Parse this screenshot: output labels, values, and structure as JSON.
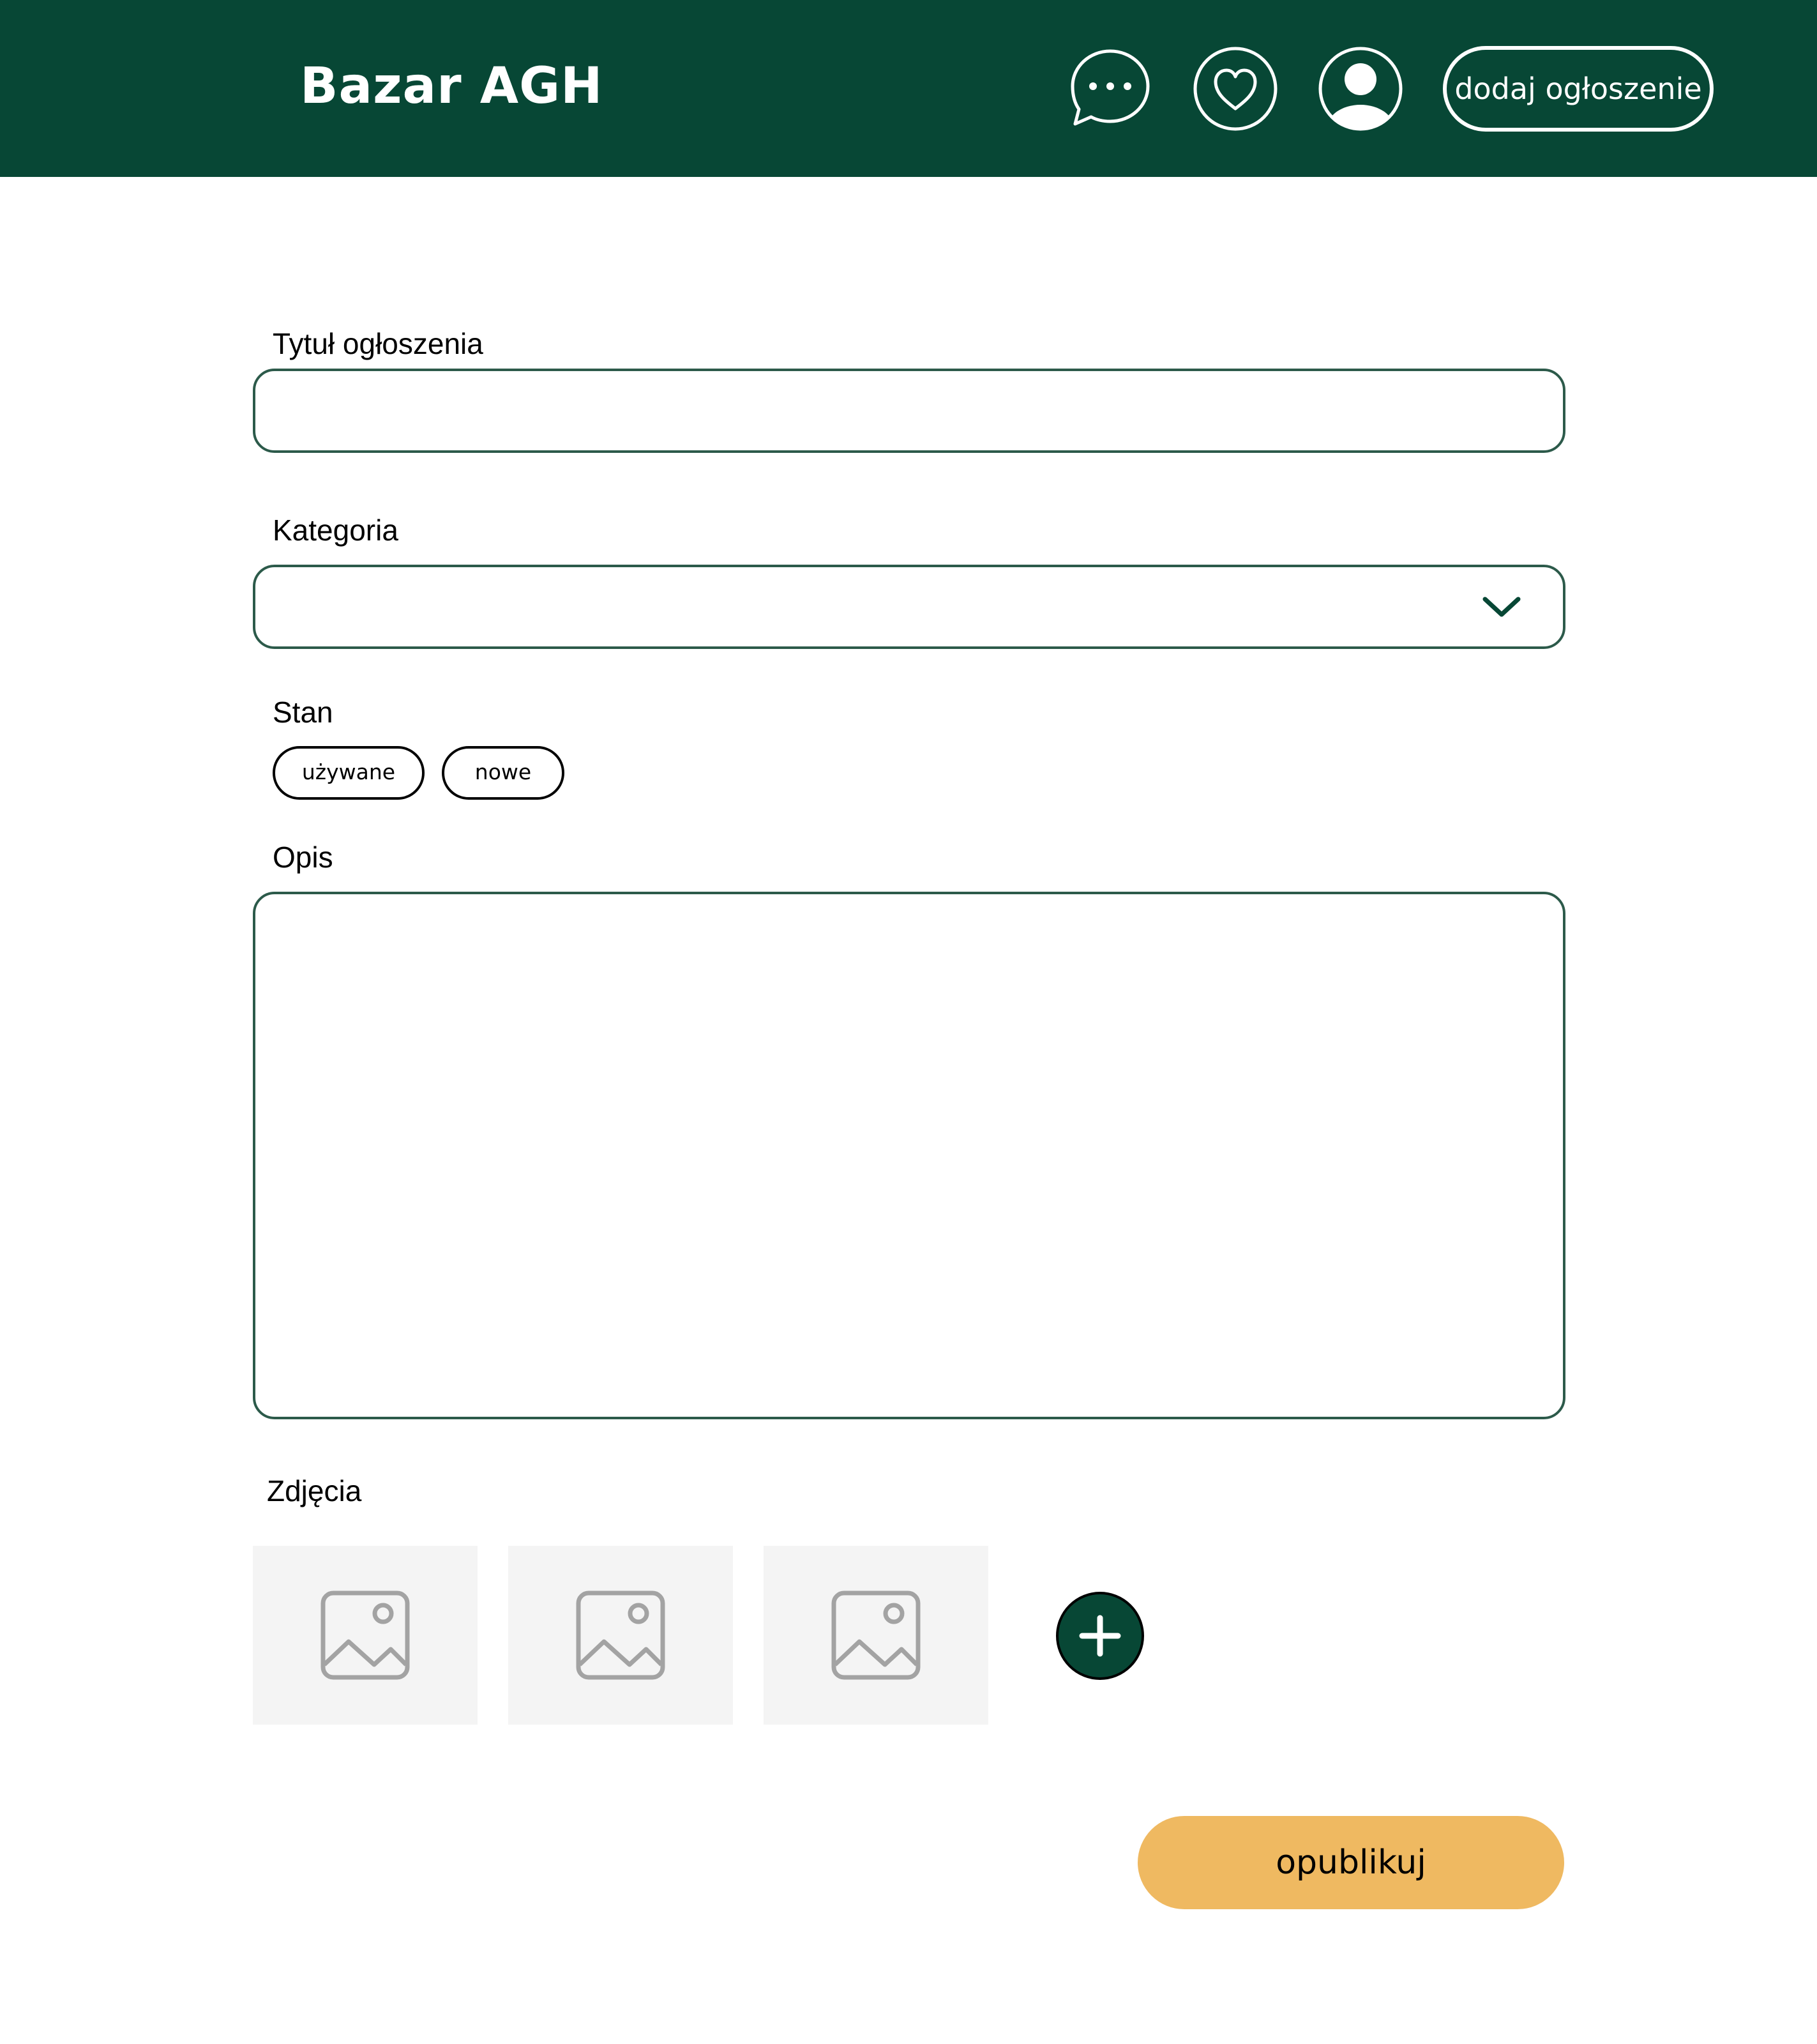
{
  "header": {
    "brand": "Bazar AGH",
    "add_ad_label": "dodaj ogłoszenie",
    "icons": [
      "chat-bubble-icon",
      "heart-icon",
      "user-avatar-icon"
    ]
  },
  "form": {
    "title_label": "Tytuł ogłoszenia",
    "title_value": "",
    "category_label": "Kategoria",
    "category_value": "",
    "condition_label": "Stan",
    "condition_options": [
      "używane",
      "nowe"
    ],
    "description_label": "Opis",
    "description_value": "",
    "photos_label": "Zdjęcia",
    "photo_slot_icon": "image-placeholder-icon",
    "add_photo_icon": "plus-icon",
    "publish_label": "opublikuj"
  },
  "colors": {
    "header_bg": "#074735",
    "field_border": "#2c5a4a",
    "publish_bg": "#efb961",
    "photo_slot_bg": "#f4f4f4",
    "placeholder_icon": "#a3a3a3"
  }
}
